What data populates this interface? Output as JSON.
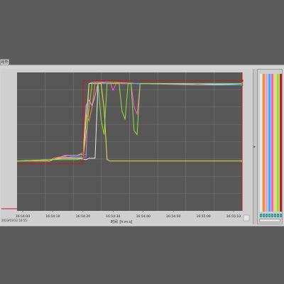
{
  "window": {
    "tab_label": "趋势",
    "corner_note": "2023/03/12 16:55:"
  },
  "colors": {
    "plot_bg": "#575757",
    "grid": "#777777",
    "accent_red": "#c41a1a",
    "setpoint": "#a93535"
  },
  "icons": {
    "divider_grip": "▸"
  },
  "chart_data": {
    "type": "line",
    "title": "",
    "xlabel": "时间",
    "xlabel_suffix": "[h:m:s]",
    "ylabel": "",
    "x_ticks": [
      "16:54:00",
      "16:54:10",
      "16:54:20",
      "16:54:30",
      "16:54:40",
      "16:54:50",
      "16:55:00",
      "16:55:10"
    ],
    "xlim": [
      0,
      75
    ],
    "ylim": [
      0,
      100
    ],
    "grid": true,
    "series": [
      {
        "color": "#e8e8e8",
        "points": [
          [
            0,
            36
          ],
          [
            11,
            36
          ],
          [
            12,
            37
          ],
          [
            15,
            38
          ],
          [
            20,
            38
          ],
          [
            23,
            37
          ],
          [
            24,
            38
          ],
          [
            26,
            38
          ],
          [
            27,
            92
          ],
          [
            30,
            93
          ],
          [
            40,
            92
          ],
          [
            50,
            92
          ],
          [
            60,
            91
          ],
          [
            70,
            91
          ],
          [
            75,
            91
          ]
        ]
      },
      {
        "color": "#ff8c2a",
        "points": [
          [
            0,
            36
          ],
          [
            11,
            36
          ],
          [
            12,
            38
          ],
          [
            17,
            40
          ],
          [
            20,
            40
          ],
          [
            22,
            42
          ],
          [
            23,
            70
          ],
          [
            24,
            65
          ],
          [
            25,
            75
          ],
          [
            26,
            92
          ],
          [
            30,
            93
          ],
          [
            40,
            92
          ],
          [
            60,
            92
          ],
          [
            75,
            92
          ]
        ]
      },
      {
        "color": "#e0a3e0",
        "points": [
          [
            0,
            36
          ],
          [
            12,
            37
          ],
          [
            16,
            40
          ],
          [
            20,
            40
          ],
          [
            22,
            41
          ],
          [
            23,
            76
          ],
          [
            24,
            80
          ],
          [
            25,
            76
          ],
          [
            26,
            83
          ],
          [
            27,
            92
          ],
          [
            40,
            92
          ],
          [
            60,
            91
          ],
          [
            75,
            92
          ]
        ]
      },
      {
        "color": "#3ab0ff",
        "points": [
          [
            0,
            36
          ],
          [
            12,
            37
          ],
          [
            18,
            39
          ],
          [
            21,
            39
          ],
          [
            23,
            41
          ],
          [
            24,
            92
          ],
          [
            25,
            93
          ],
          [
            27,
            92
          ],
          [
            40,
            92
          ],
          [
            60,
            92
          ],
          [
            75,
            91
          ]
        ]
      },
      {
        "color": "#ff5bd0",
        "points": [
          [
            0,
            36
          ],
          [
            12,
            37
          ],
          [
            16,
            39
          ],
          [
            20,
            38
          ],
          [
            23,
            39
          ],
          [
            24,
            92
          ],
          [
            26,
            93
          ],
          [
            31,
            93
          ],
          [
            32,
            87
          ],
          [
            33,
            92
          ],
          [
            38,
            92
          ],
          [
            39,
            75
          ],
          [
            40,
            70
          ],
          [
            41,
            92
          ],
          [
            75,
            92
          ]
        ]
      },
      {
        "color": "#e8e24a",
        "points": [
          [
            0,
            36
          ],
          [
            12,
            37
          ],
          [
            15,
            38
          ],
          [
            20,
            38
          ],
          [
            22,
            38
          ],
          [
            24,
            92
          ],
          [
            28,
            92
          ],
          [
            29,
            74
          ],
          [
            30,
            37
          ],
          [
            31,
            36
          ],
          [
            40,
            36
          ],
          [
            60,
            36
          ],
          [
            75,
            36
          ]
        ]
      },
      {
        "color": "#8ee03a",
        "points": [
          [
            0,
            36
          ],
          [
            13,
            37
          ],
          [
            20,
            37
          ],
          [
            22,
            38
          ],
          [
            25,
            92
          ],
          [
            27,
            92
          ],
          [
            28,
            66
          ],
          [
            29,
            55
          ],
          [
            30,
            92
          ],
          [
            34,
            92
          ],
          [
            35,
            72
          ],
          [
            36,
            66
          ],
          [
            37,
            92
          ],
          [
            38,
            92
          ],
          [
            39,
            58
          ],
          [
            40,
            55
          ],
          [
            41,
            92
          ],
          [
            75,
            92
          ]
        ]
      },
      {
        "color": "#c41a1a",
        "points": [
          [
            0,
            34
          ],
          [
            22,
            34
          ],
          [
            22,
            94
          ],
          [
            75,
            94
          ]
        ]
      }
    ]
  }
}
